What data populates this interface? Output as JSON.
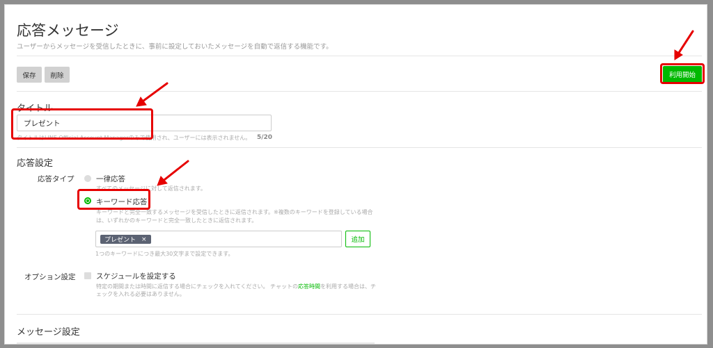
{
  "header": {
    "title": "応答メッセージ",
    "description": "ユーザーからメッセージを受信したときに、事前に設定しておいたメッセージを自動で返信する機能です。"
  },
  "toolbar": {
    "save_label": "保存",
    "delete_label": "削除",
    "start_label": "利用開始"
  },
  "title_section": {
    "label": "タイトル",
    "value": "プレゼント",
    "hint": "タイトルはLINE Official Account Managerのみで使用され、ユーザーには表示されません。",
    "counter": "5/20"
  },
  "response_settings": {
    "heading": "応答設定",
    "type_label": "応答タイプ",
    "option_uniform": "一律応答",
    "option_uniform_desc": "すべてのメッセージに対して返信されます。",
    "option_keyword": "キーワード応答",
    "option_keyword_desc_1": "キーワードと完全一致するメッセージを受信したときに返信されます。※複数のキーワードを登録している場合",
    "option_keyword_desc_2": "は、いずれかのキーワードと完全一致したときに返信されます。",
    "selected": "キーワード応答",
    "keyword_tag": "プレゼント",
    "tag_remove": "×",
    "add_label": "追加",
    "keyword_hint": "1つのキーワードにつき最大30文字まで設定できます。",
    "options_label": "オプション設定",
    "schedule_label": "スケジュールを設定する",
    "schedule_desc_1a": "特定の期間または時間に返信する場合にチェックを入れてください。 チャットの",
    "schedule_desc_link": "応答時間",
    "schedule_desc_1b": "を利用する場合は、チ",
    "schedule_desc_2": "ェックを入れる必要はありません。"
  },
  "message_settings": {
    "heading": "メッセージ設定"
  },
  "colors": {
    "accent": "#00b900",
    "annotation": "#e60000",
    "tag_bg": "#5b6272"
  }
}
